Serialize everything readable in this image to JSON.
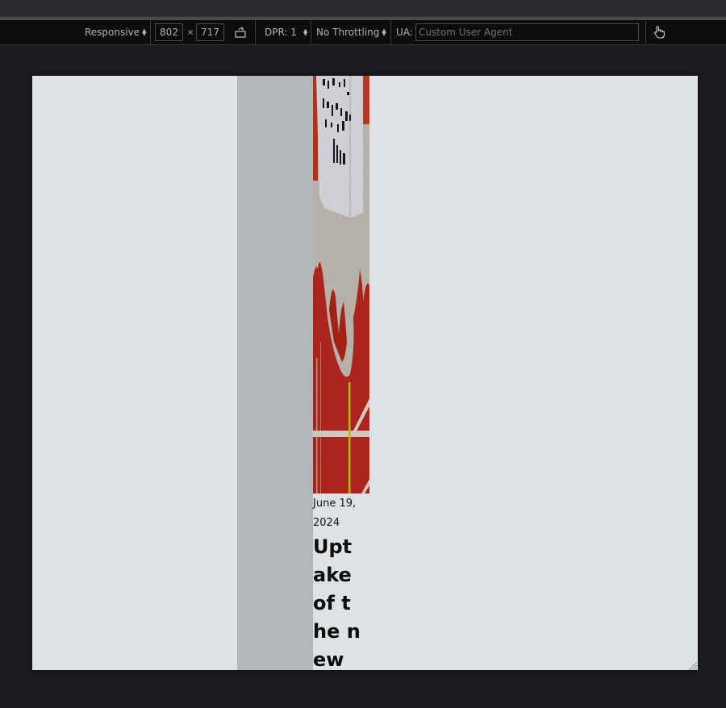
{
  "toolbar": {
    "device_label": "Responsive",
    "width_value": "802",
    "times_glyph": "×",
    "height_value": "717",
    "dpr_label": "DPR: 1",
    "throttling_label": "No Throttling",
    "ua_label": "UA:",
    "ua_placeholder": "Custom User Agent",
    "icons": {
      "rotate": "rotate-viewport-icon",
      "touch": "touch-simulation-icon"
    }
  },
  "page": {
    "article": {
      "date": "June 19, 2024",
      "title": "Uptake of the new CSS"
    }
  },
  "colors": {
    "viewport_bg": "#dfe2e4",
    "sidebar_gray": "#b4b7ba",
    "toolbar_bg": "#0c0c0d",
    "hero_red": "#b3261e"
  }
}
